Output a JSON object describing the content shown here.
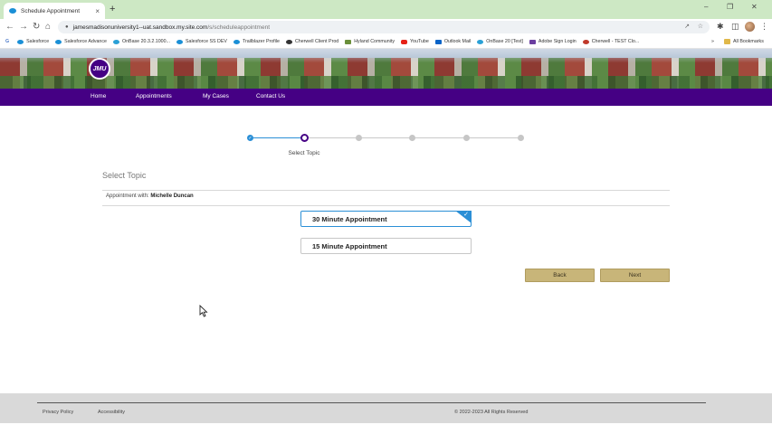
{
  "browser": {
    "tab_title": "Schedule Appointment",
    "tab_close": "×",
    "new_tab": "+",
    "url_host": "jamesmadisonuniversity1--uat.sandbox.my.site.com",
    "url_path": "/s/scheduleappointment",
    "bookmarks": [
      {
        "label": "Salesforce",
        "color": "#1a8fd6"
      },
      {
        "label": "Salesforce Advance",
        "color": "#1a8fd6"
      },
      {
        "label": "OnBase 20.3.2.1000...",
        "color": "#2aa0d6"
      },
      {
        "label": "Salesforce SS DEV",
        "color": "#1a8fd6"
      },
      {
        "label": "Trailblazer Profile",
        "color": "#1a8fd6"
      },
      {
        "label": "Cherwell Client Prod",
        "color": "#333333"
      },
      {
        "label": "Hyland Community",
        "color": "#6a8f3a"
      },
      {
        "label": "YouTube",
        "color": "#e62117"
      },
      {
        "label": "Outlook Mail",
        "color": "#0a64c8"
      },
      {
        "label": "OnBase 20 [Test]",
        "color": "#2aa0d6"
      },
      {
        "label": "Adobe Sign Login",
        "color": "#6b3fa0"
      },
      {
        "label": "Cherwell - TEST Clo...",
        "color": "#c0392b"
      }
    ],
    "bookmarks_overflow": "»",
    "all_bookmarks": "All Bookmarks"
  },
  "site": {
    "logo_text": "JMU",
    "nav": [
      "Home",
      "Appointments",
      "My Cases",
      "Contact Us"
    ],
    "colors": {
      "brand_purple": "#450084",
      "accent_blue": "#2b8fd6",
      "button_gold": "#c8b579"
    }
  },
  "wizard": {
    "current_step_label": "Select Topic",
    "section_title": "Select Topic",
    "appointment_with_label": "Appointment with:",
    "appointment_with_name": "Michelle Duncan",
    "options": [
      {
        "label": "30 Minute Appointment",
        "selected": true
      },
      {
        "label": "15 Minute Appointment",
        "selected": false
      }
    ],
    "back_label": "Back",
    "next_label": "Next"
  },
  "footer": {
    "privacy": "Privacy Policy",
    "accessibility": "Accessibility",
    "copyright": "© 2022-2023 All Rights Reserved"
  }
}
